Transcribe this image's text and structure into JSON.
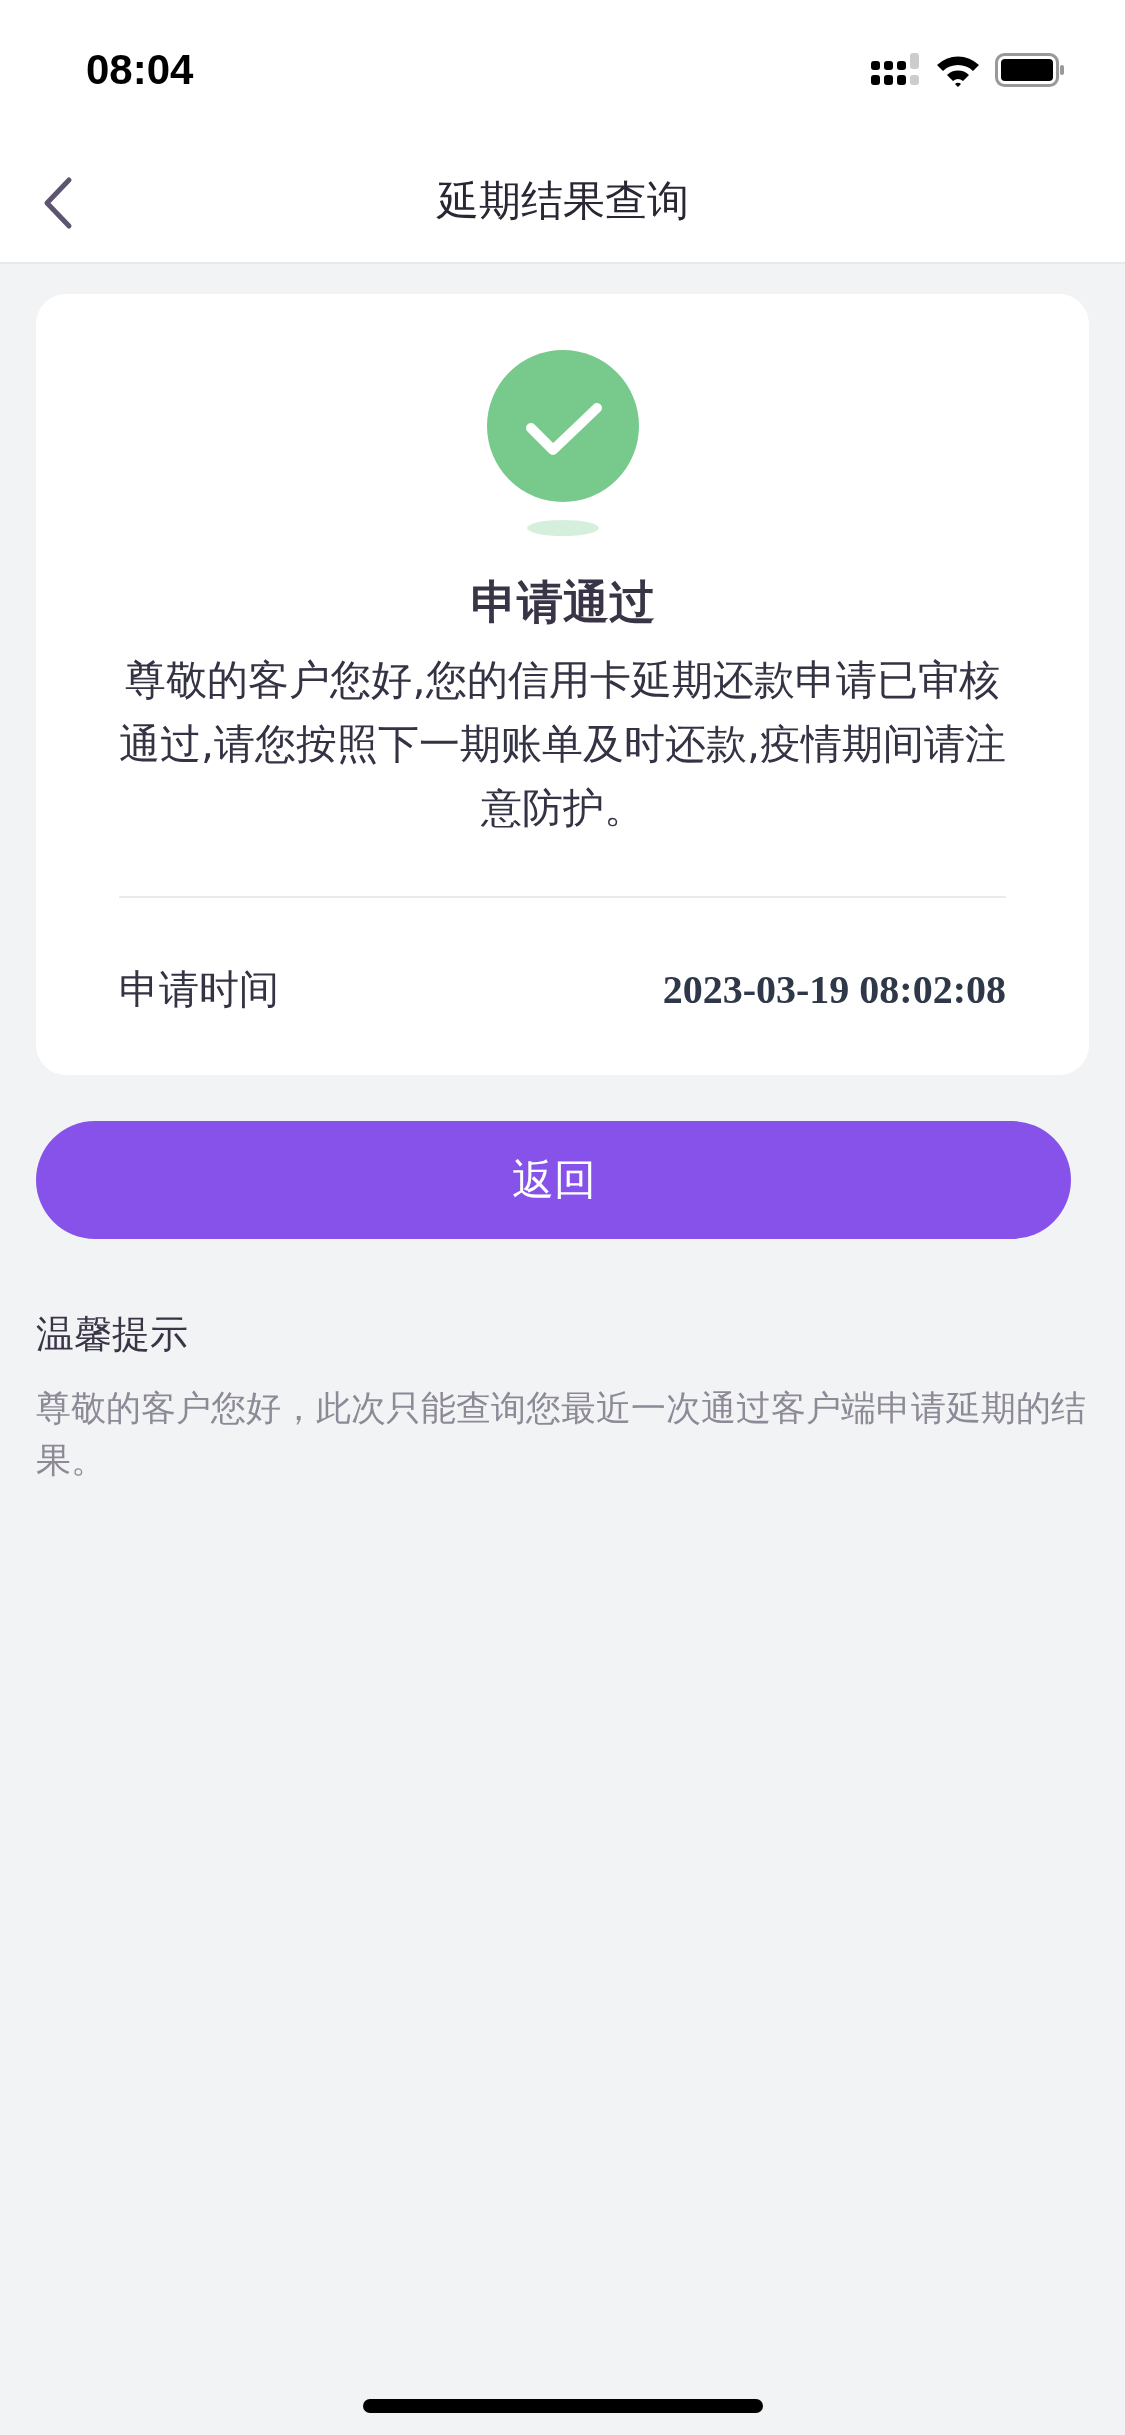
{
  "status_bar": {
    "time": "08:04"
  },
  "header": {
    "title": "延期结果查询"
  },
  "result": {
    "title": "申请通过",
    "message": "尊敬的客户您好,您的信用卡延期还款申请已审核通过,请您按照下一期账单及时还款,疫情期间请注意防护。",
    "rows": [
      {
        "label": "申请时间",
        "value": "2023-03-19 08:02:08"
      }
    ]
  },
  "button": {
    "label": "返回"
  },
  "tips": {
    "title": "温馨提示",
    "text": "尊敬的客户您好，此次只能查询您最近一次通过客户端申请延期的结果。"
  }
}
